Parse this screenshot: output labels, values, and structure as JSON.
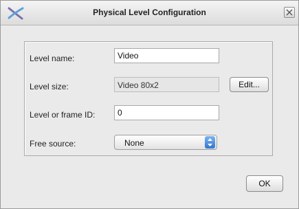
{
  "dialog": {
    "title": "Physical Level Configuration",
    "logo_icon": "x-logo-icon",
    "close_icon": "close-icon"
  },
  "form": {
    "level_name": {
      "label": "Level name:",
      "value": "Video"
    },
    "level_size": {
      "label": "Level size:",
      "value": "Video 80x2",
      "edit_label": "Edit..."
    },
    "level_id": {
      "label": "Level or frame ID:",
      "value": "0"
    },
    "free_source": {
      "label": "Free source:",
      "selected": "None",
      "arrow_icon": "updown-arrows-icon"
    }
  },
  "footer": {
    "ok_label": "OK"
  },
  "colors": {
    "accent": "#2f75d2",
    "background": "#eaeaea"
  }
}
